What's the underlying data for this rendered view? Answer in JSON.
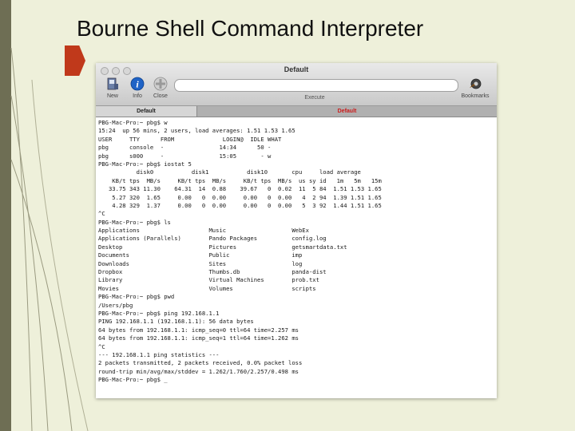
{
  "slide": {
    "title": "Bourne Shell Command Interpreter"
  },
  "window": {
    "title": "Default",
    "toolbar": {
      "new_label": "New",
      "info_label": "Info",
      "close_label": "Close",
      "execute_label": "Execute",
      "bookmarks_label": "Bookmarks",
      "command_value": ""
    },
    "tabs": [
      {
        "label": "Default",
        "active": true
      },
      {
        "label": "Default",
        "active": false
      }
    ]
  },
  "terminal": {
    "lines": [
      "PBG-Mac-Pro:~ pbg$ w",
      "15:24  up 56 mins, 2 users, load averages: 1.51 1.53 1.65",
      "USER     TTY      FROM              LOGIN@  IDLE WHAT",
      "pbg      console  -                14:34      50 -",
      "pbg      s000     -                15:05       - w",
      "PBG-Mac-Pro:~ pbg$ iostat 5",
      "           disk0           disk1           disk10       cpu     load average",
      "    KB/t tps  MB/s     KB/t tps  MB/s     KB/t tps  MB/s  us sy id   1m   5m   15m",
      "   33.75 343 11.30    64.31  14  0.88    39.67   0  0.02  11  5 84  1.51 1.53 1.65",
      "    5.27 320  1.65     0.00   0  0.00     0.00   0  0.00   4  2 94  1.39 1.51 1.65",
      "    4.28 329  1.37     0.00   0  0.00     0.00   0  0.00   5  3 92  1.44 1.51 1.65",
      "^C",
      "PBG-Mac-Pro:~ pbg$ ls",
      "Applications                    Music                   WebEx",
      "Applications (Parallels)        Pando Packages          config.log",
      "Desktop                         Pictures                getsmartdata.txt",
      "Documents                       Public                  imp",
      "Downloads                       Sites                   log",
      "Dropbox                         Thumbs.db               panda-dist",
      "Library                         Virtual Machines        prob.txt",
      "Movies                          Volumes                 scripts",
      "PBG-Mac-Pro:~ pbg$ pwd",
      "/Users/pbg",
      "PBG-Mac-Pro:~ pbg$ ping 192.168.1.1",
      "PING 192.168.1.1 (192.168.1.1): 56 data bytes",
      "64 bytes from 192.168.1.1: icmp_seq=0 ttl=64 time=2.257 ms",
      "64 bytes from 192.168.1.1: icmp_seq=1 ttl=64 time=1.262 ms",
      "^C",
      "--- 192.168.1.1 ping statistics ---",
      "2 packets transmitted, 2 packets received, 0.0% packet loss",
      "round-trip min/avg/max/stddev = 1.262/1.760/2.257/0.498 ms",
      "PBG-Mac-Pro:~ pbg$ _"
    ]
  },
  "colors": {
    "background": "#eef0da",
    "accent_tab": "#cc1b1b",
    "slide_tab": "#c0391b",
    "left_bar": "#6e6e54"
  }
}
